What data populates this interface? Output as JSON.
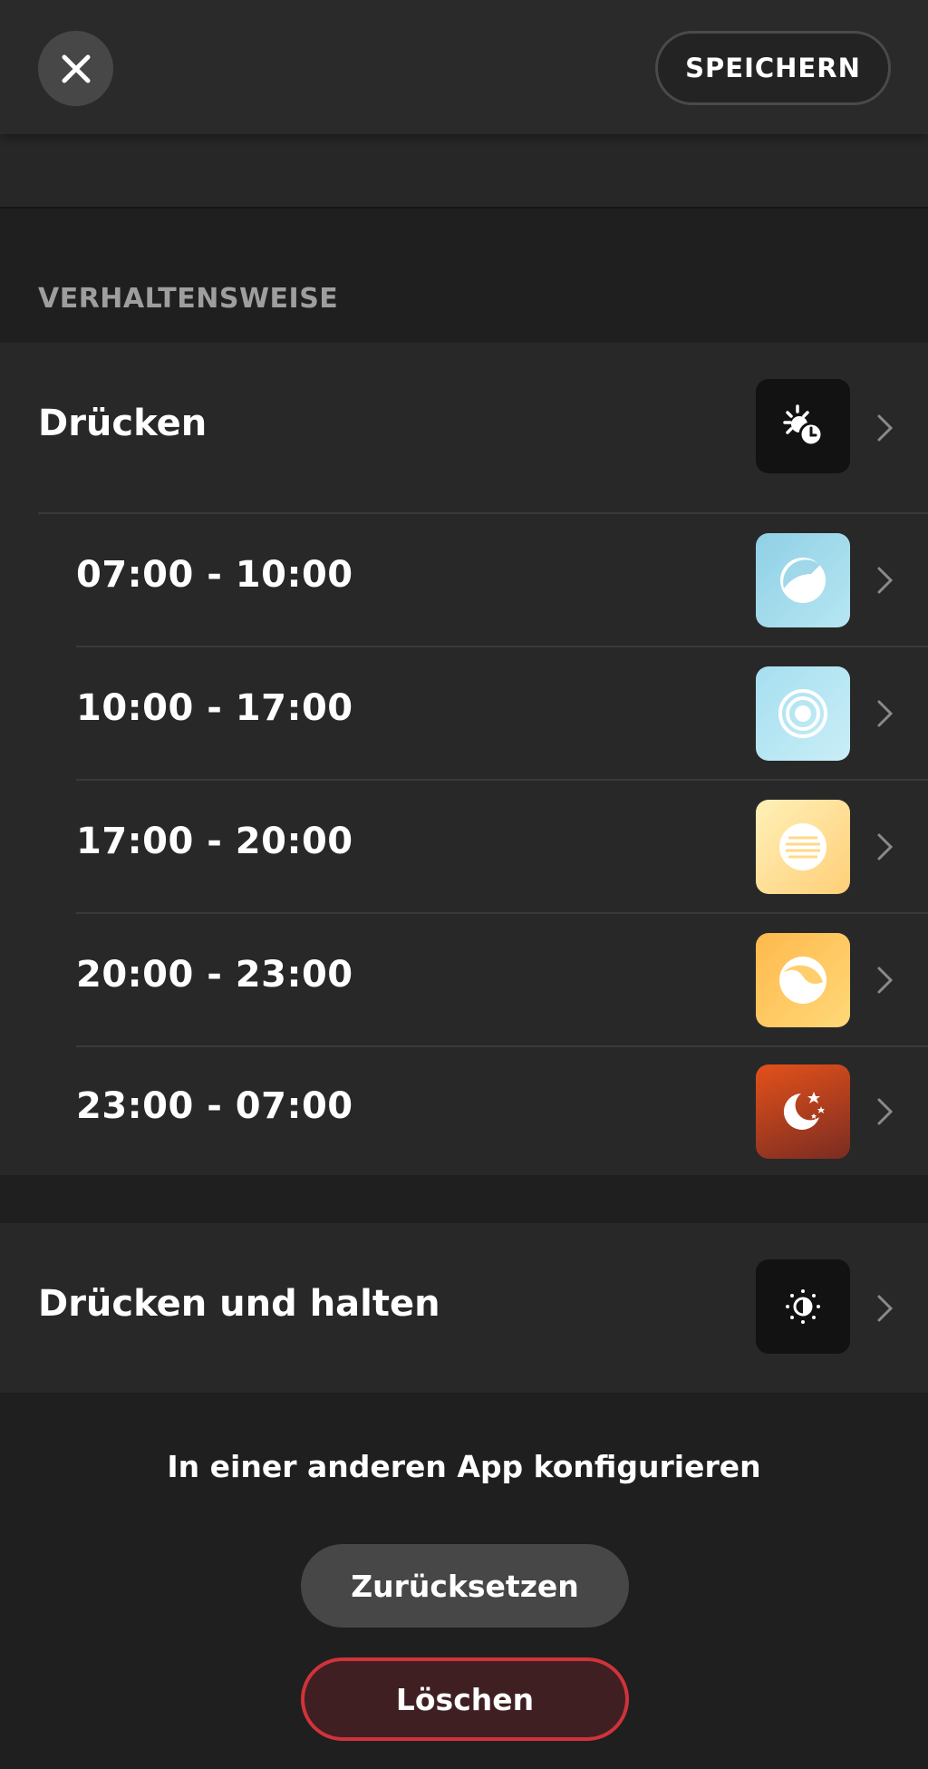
{
  "header": {
    "close_icon": "close-icon",
    "save_label": "SPEICHERN"
  },
  "section": {
    "title": "VERHALTENSWEISE"
  },
  "press": {
    "label": "Drücken",
    "icon": "scene-time-icon"
  },
  "time_slots": [
    {
      "label": "07:00 - 10:00",
      "icon": "energize-icon",
      "colors": [
        "#8fd0e6",
        "#b7e6f2"
      ]
    },
    {
      "label": "10:00 - 17:00",
      "icon": "concentrate-icon",
      "colors": [
        "#a6dff0",
        "#c9eef7"
      ]
    },
    {
      "label": "17:00 - 20:00",
      "icon": "read-icon",
      "colors": [
        "#fde6a6",
        "#ffd27a"
      ]
    },
    {
      "label": "20:00 - 23:00",
      "icon": "relax-icon",
      "colors": [
        "#ffc96a",
        "#ffb54d"
      ]
    },
    {
      "label": "23:00 - 07:00",
      "icon": "nightlight-icon",
      "colors": [
        "#e24a18",
        "#7a2a1e"
      ]
    }
  ],
  "press_hold": {
    "label": "Drücken und halten",
    "icon": "brightness-icon"
  },
  "configure_other_app": "In einer anderen App konfigurieren",
  "reset_label": "Zurücksetzen",
  "delete_label": "Löschen",
  "colors": {
    "background": "#1f1f1f",
    "card": "#282828",
    "delete_border": "#d0333b"
  }
}
